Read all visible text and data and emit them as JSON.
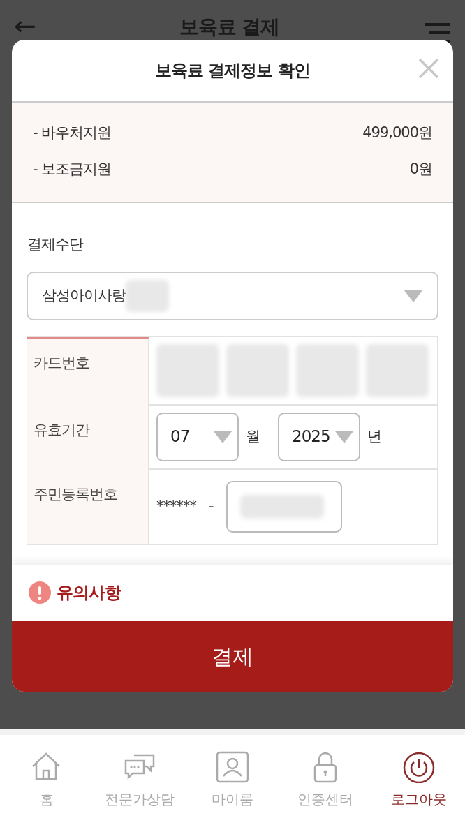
{
  "page_header": {
    "back_icon": "←",
    "title": "보육료 결제"
  },
  "modal": {
    "title": "보육료 결제정보 확인",
    "summary": [
      {
        "label": "- 바우처지원",
        "amount": "499,000원"
      },
      {
        "label": "- 보조금지원",
        "amount": "0원"
      }
    ],
    "payment_method": {
      "label": "결제수단",
      "value": "삼성아이사랑"
    },
    "card_form": {
      "card_number_label": "카드번호",
      "expiry_label": "유효기간",
      "expiry_month": "07",
      "month_unit": "월",
      "expiry_year": "2025",
      "year_unit": "년",
      "resident_label": "주민등록번호",
      "resident_front": "******",
      "resident_separator": "-"
    },
    "notice": {
      "title": "유의사항"
    },
    "submit_button": "결제"
  },
  "bottom_nav": [
    {
      "label": "홈",
      "kind": "home",
      "selected": false
    },
    {
      "label": "전문가상담",
      "kind": "chat",
      "selected": false
    },
    {
      "label": "마이룸",
      "kind": "person",
      "selected": false
    },
    {
      "label": "인증센터",
      "kind": "lock",
      "selected": false
    },
    {
      "label": "로그아웃",
      "kind": "power",
      "selected": true
    }
  ]
}
